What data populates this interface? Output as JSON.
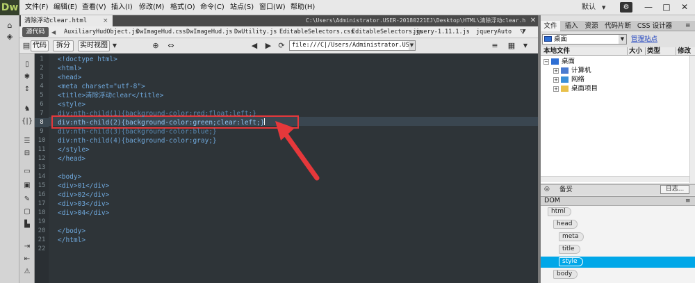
{
  "app": {
    "logo": "Dw"
  },
  "menu": [
    "文件(F)",
    "编辑(E)",
    "查看(V)",
    "插入(I)",
    "修改(M)",
    "格式(O)",
    "命令(C)",
    "站点(S)",
    "窗口(W)",
    "帮助(H)"
  ],
  "workspace": "默认",
  "window_controls": {
    "minimize": "—",
    "restore": "□",
    "close": "✕"
  },
  "document": {
    "tab_label": "清除浮动clear.html",
    "tab_close": "×",
    "path": "C:\\Users\\Administrator.USER-20180221EJ\\Desktop\\HTML\\清除浮动clear.html",
    "close": "✕"
  },
  "related_files": {
    "source_label": "源代码",
    "files": [
      "AuxiliaryHudObject.js",
      "DwImageHud.css",
      "DwImageHud.js",
      "DwUtility.js",
      "EditableSelectors.css",
      "EditableSelectors.js",
      "jquery-1.11.1.js",
      "jqueryAuto"
    ]
  },
  "view_toolbar": {
    "code": "代码",
    "split": "拆分",
    "live": "实时视图",
    "address": "file:///C|/Users/Administrator.USER-20"
  },
  "editor": {
    "current_line": 8,
    "lines": [
      "<!doctype html>",
      "<html>",
      "<head>",
      "<meta charset=\"utf-8\">",
      "<title>清除浮动clear</title>",
      "<style>",
      "div:nth-child(1){background-color:red;float:left;}",
      "div:nth-child(2){background-color:green;clear:left;}",
      "div:nth-child(3){background-color:blue;}",
      "div:nth-child(4){background-color:gray;}",
      "</style>",
      "</head>",
      "",
      "<body>",
      "<div>01</div>",
      "<div>02</div>",
      "<div>03</div>",
      "<div>04</div>",
      "",
      "</body>",
      "</html>",
      ""
    ]
  },
  "right_panel": {
    "tabs": [
      "文件",
      "插入",
      "资源",
      "代码片断",
      "CSS 设计器"
    ],
    "site_select": "桌面",
    "manage_site": "管理站点",
    "columns": [
      "本地文件",
      "大小",
      "类型",
      "修改"
    ],
    "tree": [
      {
        "label": "桌面",
        "level": 0,
        "expander": "−",
        "icon_color": "#2e6fd4"
      },
      {
        "label": "计算机",
        "level": 1,
        "expander": "+",
        "icon_color": "#4a7bd0"
      },
      {
        "label": "网络",
        "level": 1,
        "expander": "+",
        "icon_color": "#3a8fd8"
      },
      {
        "label": "桌面项目",
        "level": 1,
        "expander": "+",
        "icon_color": "#e8c04a"
      }
    ],
    "status": "备妥",
    "log_button": "日志..."
  },
  "dom_panel": {
    "title": "DOM",
    "nodes": [
      {
        "tag": "html",
        "level": 0,
        "selected": false
      },
      {
        "tag": "head",
        "level": 1,
        "selected": false
      },
      {
        "tag": "meta",
        "level": 2,
        "selected": false
      },
      {
        "tag": "title",
        "level": 2,
        "selected": false
      },
      {
        "tag": "style",
        "level": 2,
        "selected": true
      },
      {
        "tag": "body",
        "level": 1,
        "selected": false
      }
    ]
  },
  "colors": {
    "highlight_box": "#e5383b",
    "dom_selected": "#00a7e8",
    "editor_bg": "#2e3438"
  }
}
